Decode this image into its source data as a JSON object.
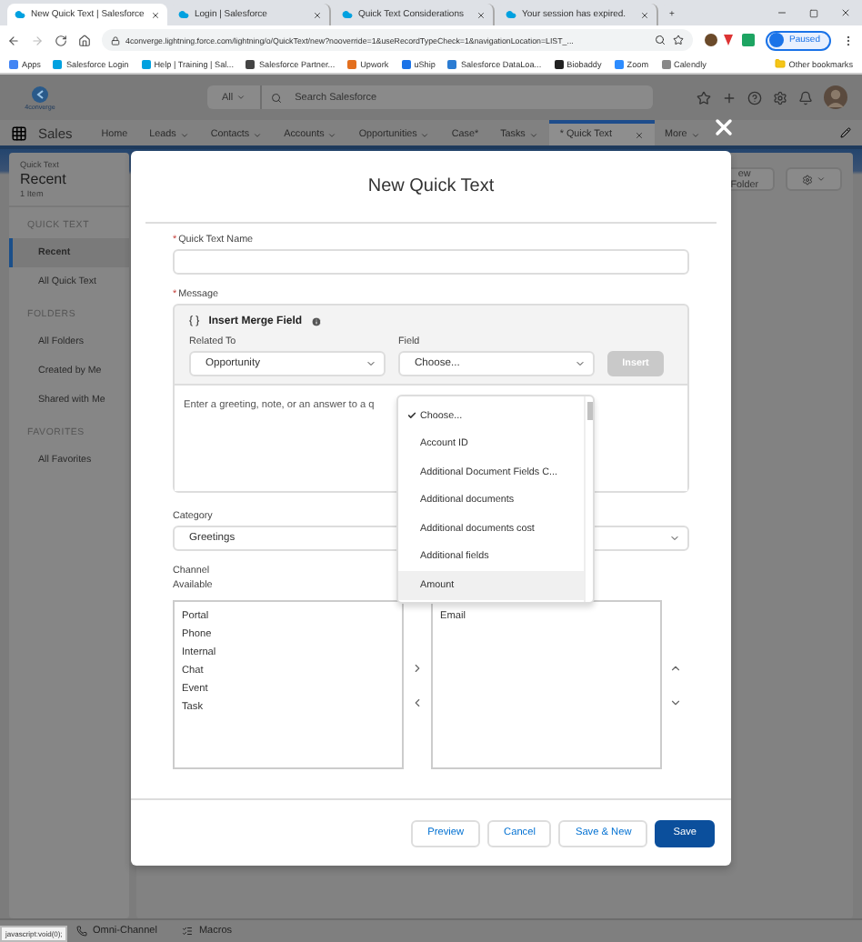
{
  "browser": {
    "tabs": [
      {
        "label": "New Quick Text | Salesforce",
        "selected": true
      },
      {
        "label": "Login | Salesforce",
        "selected": false
      },
      {
        "label": "Quick Text Considerations",
        "selected": false
      },
      {
        "label": "Your session has expired.",
        "selected": false
      }
    ],
    "new_tab": "+",
    "address": "4converge.lightning.force.com/lightning/o/QuickText/new?nooverride=1&useRecordTypeCheck=1&navigationLocation=LIST_...",
    "profile": "Paused",
    "bookmarks": [
      "Apps",
      "Salesforce Login",
      "Help | Training | Sal...",
      "Salesforce Partner...",
      "Upwork",
      "uShip",
      "Salesforce DataLoa...",
      "Biobaddy",
      "Zoom",
      "Calendly"
    ],
    "other_bookmarks": "Other bookmarks"
  },
  "app": {
    "logo": "4converge",
    "search_scope": "All",
    "search_placeholder": "Search Salesforce",
    "app_name": "Sales",
    "nav": [
      {
        "label": "Home",
        "kind": "plain",
        "selected": false
      },
      {
        "label": "Leads",
        "kind": "menu",
        "selected": false
      },
      {
        "label": "Contacts",
        "kind": "menu",
        "selected": false
      },
      {
        "label": "Accounts",
        "kind": "menu",
        "selected": false
      },
      {
        "label": "Opportunities",
        "kind": "menu",
        "selected": false
      },
      {
        "label": "Case*",
        "kind": "plain",
        "selected": false
      },
      {
        "label": "Tasks",
        "kind": "menu",
        "selected": false
      },
      {
        "label": "* Quick Text",
        "kind": "workspace",
        "selected": true
      }
    ],
    "more": "More"
  },
  "sidebar": {
    "object": "Quick Text",
    "title": "Recent",
    "count": "1 Item",
    "sections": [
      {
        "heading": "QUICK TEXT",
        "items": [
          {
            "label": "Recent",
            "selected": true
          },
          {
            "label": "All Quick Text",
            "selected": false
          }
        ]
      },
      {
        "heading": "FOLDERS",
        "items": [
          {
            "label": "All Folders",
            "selected": false
          },
          {
            "label": "Created by Me",
            "selected": false
          },
          {
            "label": "Shared with Me",
            "selected": false
          }
        ]
      },
      {
        "heading": "FAVORITES",
        "items": [
          {
            "label": "All Favorites",
            "selected": false
          }
        ]
      }
    ]
  },
  "list_header": {
    "new_folder": "ew Folder"
  },
  "modal": {
    "title": "New Quick Text",
    "name_field": {
      "required": "*",
      "label": "Quick Text Name"
    },
    "message_field": {
      "required": "*",
      "label": "Message",
      "placeholder": "Enter a greeting, note, or an answer to a q"
    },
    "merge": {
      "braces": "{ }",
      "title": "Insert Merge Field",
      "related_label": "Related To",
      "related_value": "Opportunity",
      "field_label": "Field",
      "field_value": "Choose...",
      "insert": "Insert",
      "insert_disabled": true,
      "options": [
        {
          "label": "Choose...",
          "selected": true,
          "highlighted": false
        },
        {
          "label": "Account ID",
          "selected": false,
          "highlighted": false
        },
        {
          "label": "Additional Document Fields C...",
          "selected": false,
          "highlighted": false
        },
        {
          "label": "Additional documents",
          "selected": false,
          "highlighted": false
        },
        {
          "label": "Additional documents cost",
          "selected": false,
          "highlighted": false
        },
        {
          "label": "Additional fields",
          "selected": false,
          "highlighted": false
        },
        {
          "label": "Amount",
          "selected": false,
          "highlighted": true
        }
      ]
    },
    "category": {
      "label": "Category",
      "value": "Greetings"
    },
    "channel": {
      "label": "Channel",
      "available_label": "Available",
      "available": [
        "Portal",
        "Phone",
        "Internal",
        "Chat",
        "Event",
        "Task"
      ],
      "chosen": [
        "Email"
      ]
    },
    "buttons": [
      {
        "label": "Preview",
        "kind": "neutral"
      },
      {
        "label": "Cancel",
        "kind": "neutral"
      },
      {
        "label": "Save & New",
        "kind": "neutral"
      },
      {
        "label": "Save",
        "kind": "brand"
      }
    ]
  },
  "utility_bar": [
    "Omni-Channel",
    "Macros"
  ],
  "status_url": "javascript:void(0);"
}
